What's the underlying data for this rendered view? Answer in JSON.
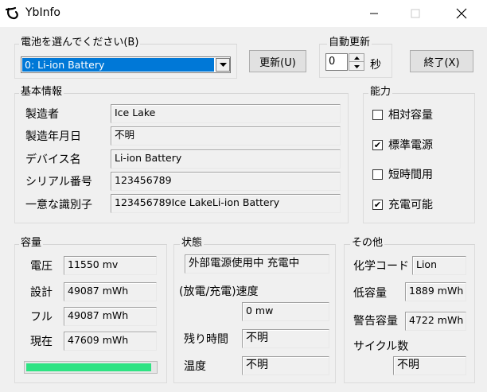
{
  "window": {
    "title": "YbInfo"
  },
  "battery_select": {
    "label": "電池を選んでください(B)",
    "selected": "0: Li-ion Battery"
  },
  "buttons": {
    "update": "更新(U)",
    "exit": "終了(X)"
  },
  "auto_update": {
    "label": "自動更新",
    "value": "0",
    "unit": "秒"
  },
  "basic_info": {
    "label": "基本情報",
    "rows": [
      {
        "label": "製造者",
        "value": "Ice Lake"
      },
      {
        "label": "製造年月日",
        "value": "不明"
      },
      {
        "label": "デバイス名",
        "value": "Li-ion Battery"
      },
      {
        "label": "シリアル番号",
        "value": "123456789"
      },
      {
        "label": "一意な識別子",
        "value": "123456789Ice LakeLi-ion Battery"
      }
    ]
  },
  "capabilities": {
    "label": "能力",
    "items": [
      {
        "label": "相対容量",
        "checked": false
      },
      {
        "label": "標準電源",
        "checked": true
      },
      {
        "label": "短時間用",
        "checked": false
      },
      {
        "label": "充電可能",
        "checked": true
      }
    ]
  },
  "capacity": {
    "label": "容量",
    "rows": [
      {
        "label": "電圧",
        "value": "11550 mv"
      },
      {
        "label": "設計",
        "value": "49087 mWh"
      },
      {
        "label": "フル",
        "value": "49087 mWh"
      },
      {
        "label": "現在",
        "value": "47609 mWh"
      }
    ],
    "charge_fraction": 0.97,
    "bar_color": "#2ee383"
  },
  "status": {
    "label": "状態",
    "power_state": "外部電源使用中 充電中",
    "rate_label": "(放電/充電)速度",
    "rate_value": "0 mw",
    "remaining_label": "残り時間",
    "remaining_value": "不明",
    "temp_label": "温度",
    "temp_value": "不明"
  },
  "other": {
    "label": "その他",
    "chemistry_label": "化学コード",
    "chemistry_value": "Lion",
    "low_label": "低容量",
    "low_value": "1889 mWh",
    "warn_label": "警告容量",
    "warn_value": "4722 mWh",
    "cycle_label": "サイクル数",
    "cycle_value": "不明"
  }
}
